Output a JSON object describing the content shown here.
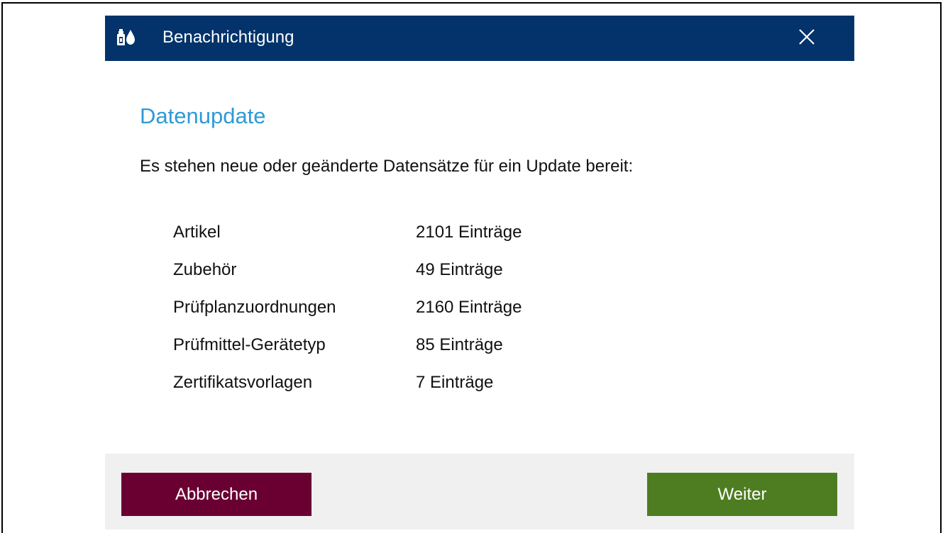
{
  "window": {
    "title": "Benachrichtigung",
    "app_icon": "bottle-drop-icon",
    "close_icon": "close-icon",
    "title_bar_color": "#03336a"
  },
  "content": {
    "heading": "Datenupdate",
    "heading_color": "#2f9ad6",
    "message": "Es stehen neue oder geänderte Datensätze für ein Update bereit:",
    "entries": [
      {
        "name": "Artikel",
        "count": "2101 Einträge"
      },
      {
        "name": "Zubehör",
        "count": "49 Einträge"
      },
      {
        "name": "Prüfplanzuordnungen",
        "count": "2160 Einträge"
      },
      {
        "name": "Prüfmittel-Gerätetyp",
        "count": "85 Einträge"
      },
      {
        "name": "Zertifikatsvorlagen",
        "count": "7 Einträge"
      }
    ]
  },
  "footer": {
    "cancel_label": "Abbrechen",
    "cancel_color": "#6a0032",
    "next_label": "Weiter",
    "next_color": "#4e7d21"
  }
}
